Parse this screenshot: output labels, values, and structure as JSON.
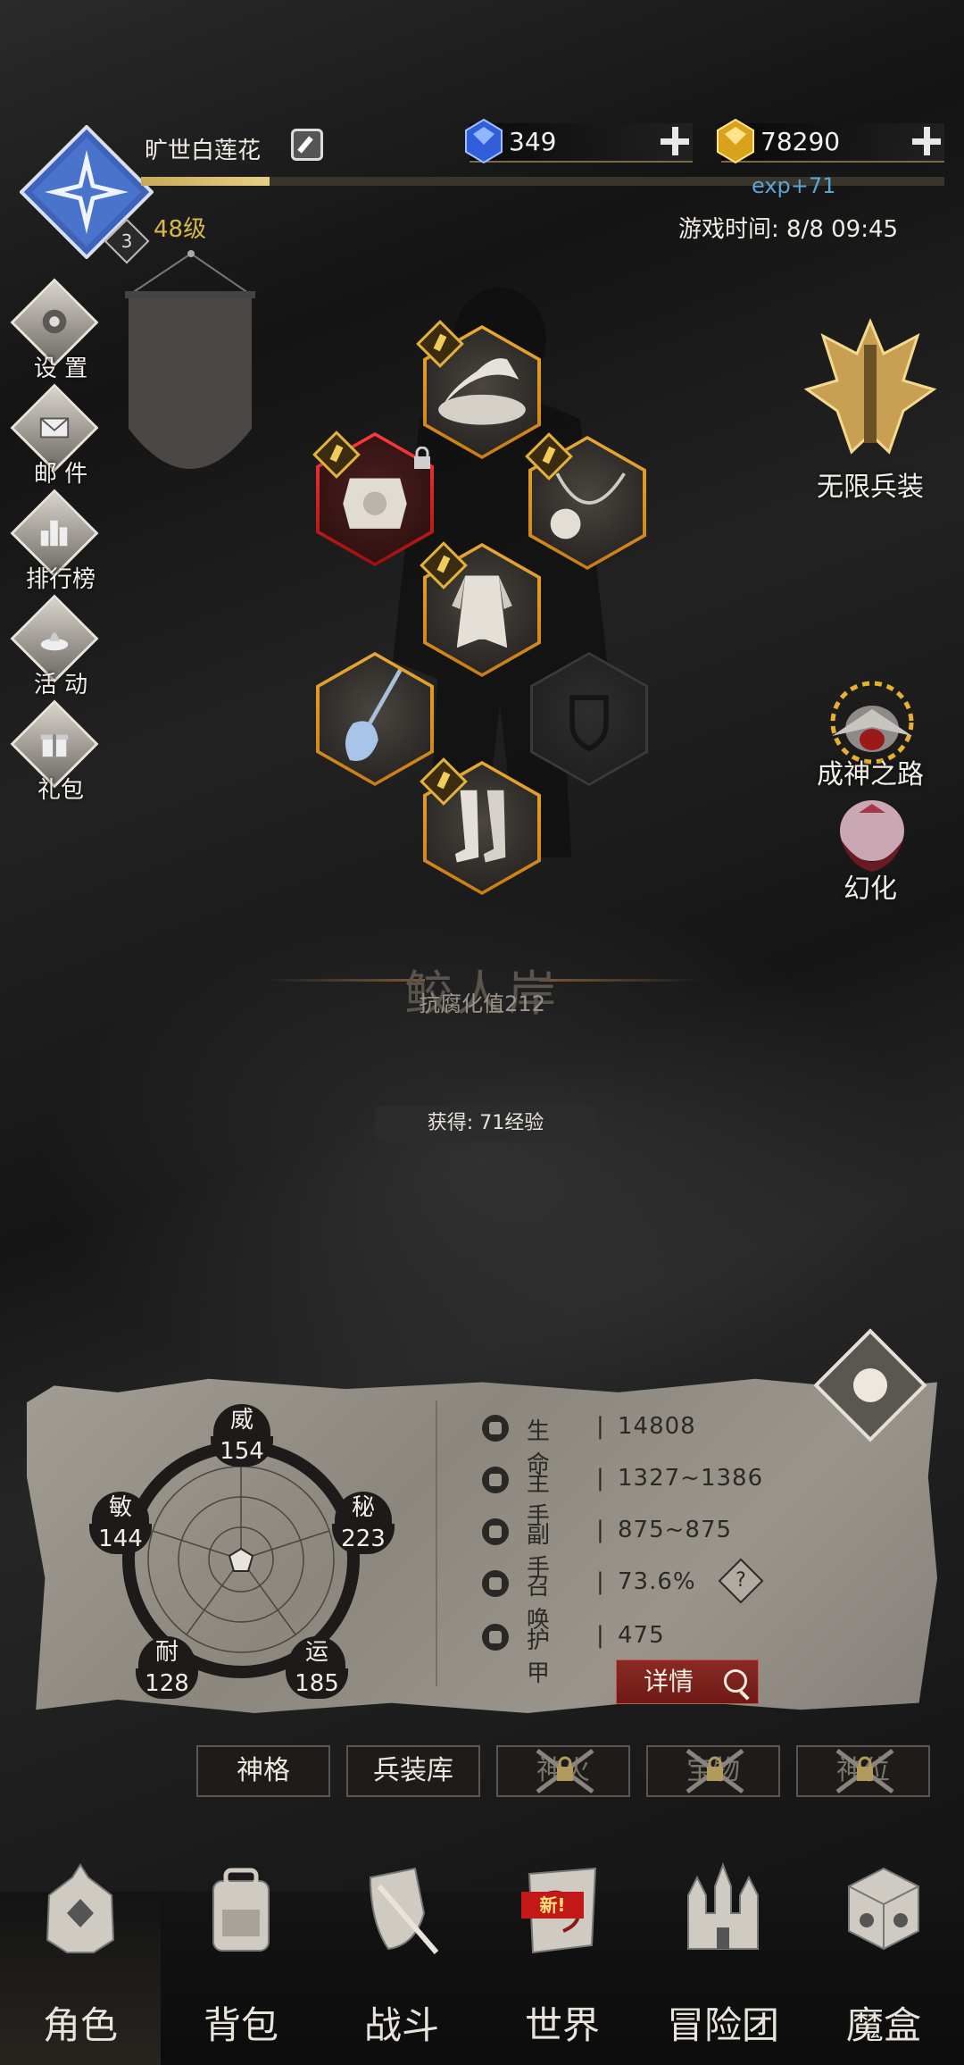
{
  "header": {
    "player_name": "旷世白莲花",
    "level_badge": "3",
    "level_text": "48级",
    "exp_gain": "exp+71",
    "exp_progress": 0.16,
    "game_time": "游戏时间: 8/8 09:45",
    "gems": "349",
    "gold": "78290"
  },
  "side_menu": [
    {
      "label": "设 置",
      "icon": "gear-icon"
    },
    {
      "label": "邮 件",
      "icon": "mail-icon"
    },
    {
      "label": "排行榜",
      "icon": "ranking-icon"
    },
    {
      "label": "活 动",
      "icon": "event-icon"
    },
    {
      "label": "礼包",
      "icon": "gift-icon"
    }
  ],
  "features": {
    "infinite_equip": "无限兵装",
    "path_to_god": "成神之路",
    "transform": "幻化"
  },
  "dungeon": {
    "name": "鲛人岸",
    "corrosion": "抗腐化值212",
    "reward": "获得: 71经验"
  },
  "attributes": [
    {
      "name": "威",
      "value": "154"
    },
    {
      "name": "秘",
      "value": "223"
    },
    {
      "name": "运",
      "value": "185"
    },
    {
      "name": "耐",
      "value": "128"
    },
    {
      "name": "敏",
      "value": "144"
    }
  ],
  "stats": [
    {
      "label": "生命",
      "sep": "|",
      "value": "14808",
      "icon": "heart-icon"
    },
    {
      "label": "主手",
      "sep": "|",
      "value": "1327~1386",
      "icon": "sword-icon"
    },
    {
      "label": "副手",
      "sep": "|",
      "value": "875~875",
      "icon": "offhand-icon"
    },
    {
      "label": "召唤",
      "sep": "|",
      "value": "73.6%",
      "icon": "summon-icon"
    },
    {
      "label": "护甲",
      "sep": "|",
      "value": "475",
      "icon": "armor-icon"
    }
  ],
  "help_label": "?",
  "detail_button": "详情",
  "sub_tabs": [
    {
      "label": "神格",
      "locked": false
    },
    {
      "label": "兵装库",
      "locked": false
    },
    {
      "label": "神火",
      "locked": true
    },
    {
      "label": "宝物",
      "locked": true
    },
    {
      "label": "神位",
      "locked": true
    }
  ],
  "nav": [
    {
      "label": "角色",
      "icon": "helmet-icon",
      "active": true
    },
    {
      "label": "背包",
      "icon": "backpack-icon",
      "active": false
    },
    {
      "label": "战斗",
      "icon": "shield-sword-icon",
      "active": false
    },
    {
      "label": "世界",
      "icon": "map-scroll-icon",
      "active": false
    },
    {
      "label": "冒险团",
      "icon": "castle-icon",
      "active": false
    },
    {
      "label": "魔盒",
      "icon": "magic-cube-icon",
      "active": false
    }
  ],
  "new_badge": "新!",
  "colors": {
    "gold_accent": "#e9a832",
    "red_accent": "#d81e1e",
    "exp_blue": "#58a6d6",
    "level_yellow": "#d8b84a"
  }
}
